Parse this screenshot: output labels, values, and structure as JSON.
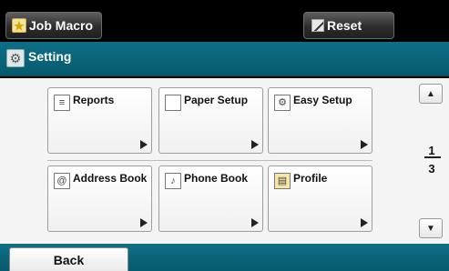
{
  "topbar": {
    "job_macro_label": "Job Macro",
    "job_macro_icon": "star-icon",
    "reset_label": "Reset",
    "reset_icon": "reset-icon"
  },
  "header": {
    "title": "Setting",
    "icon": "gear-icon"
  },
  "tiles": [
    {
      "label": "Reports",
      "icon": "report-icon"
    },
    {
      "label": "Paper Setup",
      "icon": "paper-icon"
    },
    {
      "label": "Easy Setup",
      "icon": "easy-setup-icon"
    },
    {
      "label": "Address Book",
      "icon": "address-book-icon"
    },
    {
      "label": "Phone Book",
      "icon": "phone-book-icon"
    },
    {
      "label": "Profile",
      "icon": "profile-icon"
    }
  ],
  "pager": {
    "current": "1",
    "total": "3"
  },
  "footer": {
    "back_label": "Back"
  },
  "colors": {
    "header_bg": "#0a6478",
    "topbar_bg": "#000000",
    "panel_bg": "#f4f4f4"
  }
}
